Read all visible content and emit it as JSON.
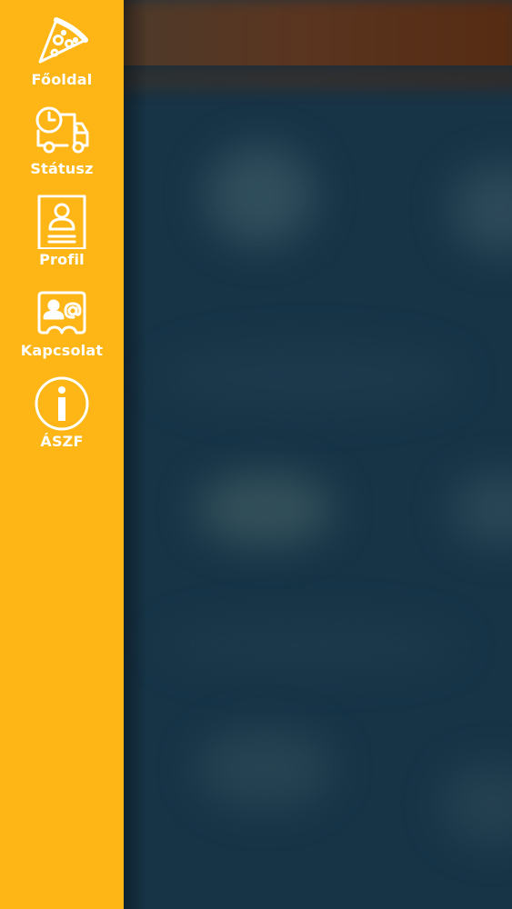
{
  "sidebar": {
    "background": "#FDB615",
    "items": [
      {
        "label": "Főoldal",
        "icon": "pizza-slice-icon"
      },
      {
        "label": "Státusz",
        "icon": "delivery-truck-clock-icon"
      },
      {
        "label": "Profil",
        "icon": "profile-card-icon"
      },
      {
        "label": "Kapcsolat",
        "icon": "contact-card-icon"
      },
      {
        "label": "ÁSZF",
        "icon": "info-icon"
      }
    ]
  },
  "colors": {
    "sidebar": "#FDB615",
    "icon_and_text": "#FFFFFF",
    "background_main": "#173447",
    "background_header": "#562B12"
  }
}
